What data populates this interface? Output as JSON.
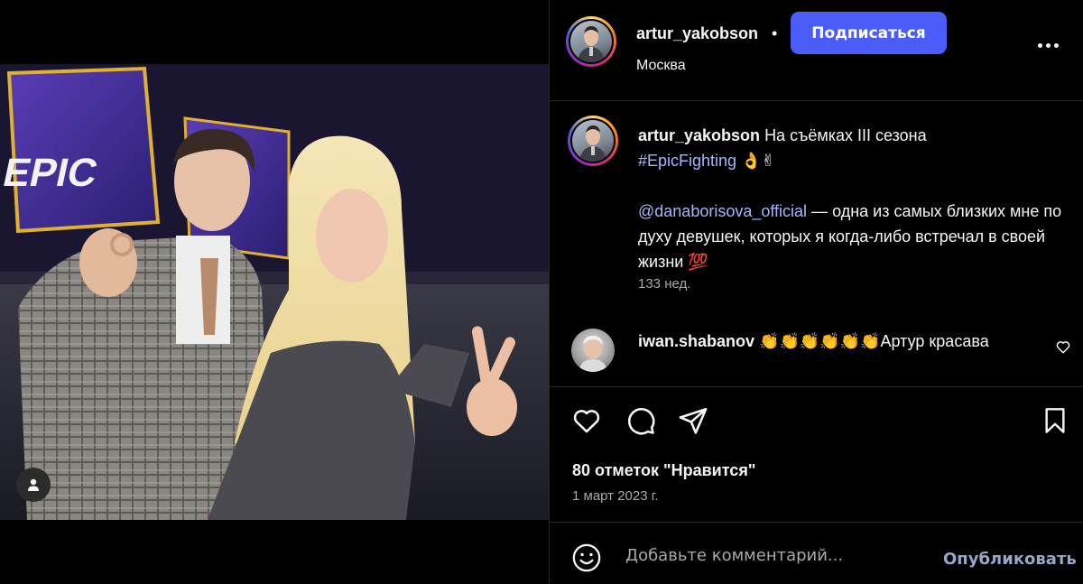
{
  "post": {
    "username": "artur_yakobson",
    "dot": "•",
    "follow_label": "Подписаться",
    "location": "Москва"
  },
  "caption": {
    "username": "artur_yakobson",
    "text_part1": "На съёмках III сезона",
    "hashtag": "#EpicFighting",
    "emoji1": "👌✌",
    "mention": "@danaborisova_official",
    "text_part2": "— одна из самых близких мне по духу девушек, которых я когда-либо встречал в своей жизни",
    "emoji2": "💯",
    "age": "133 нед."
  },
  "comment": {
    "username": "iwan.shabanov",
    "emojis": "👏👏👏👏👏👏",
    "text": "Артур красава"
  },
  "stats": {
    "likes": "80 отметок \"Нравится\"",
    "date": "1 март 2023 г."
  },
  "composer": {
    "placeholder": "Добавьте комментарий...",
    "publish_label": "Опубликовать"
  },
  "photo": {
    "sign_text": "EPIC"
  },
  "icons": {
    "more": "more-options-icon",
    "like": "heart-icon",
    "comment": "comment-bubble-icon",
    "share": "paper-plane-icon",
    "save": "bookmark-icon",
    "emoji": "emoji-smile-icon",
    "tag": "user-tag-icon"
  },
  "colors": {
    "follow_button": "#4a5df9",
    "link": "#a8b4ff"
  }
}
